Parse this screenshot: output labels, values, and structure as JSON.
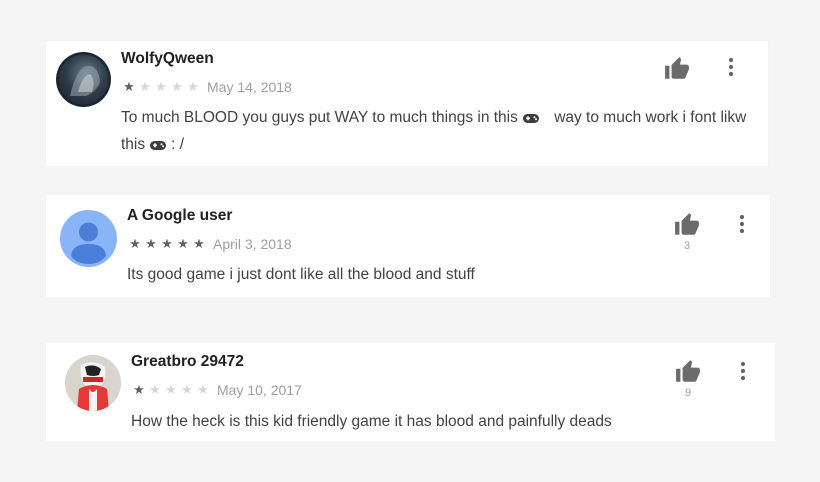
{
  "reviews": [
    {
      "name": "WolfyQween",
      "rating": 1,
      "date": "May 14, 2018",
      "text_a": "To much BLOOD you guys put WAY to much things in this",
      "text_b": "way to much work i font likw",
      "text_c": "this",
      "text_d": ": /",
      "helpful_count": "",
      "avatar_text": "WolfyQween"
    },
    {
      "name": "A Google user",
      "rating": 5,
      "date": "April 3, 2018",
      "text_a": "Its good game i just dont like all the blood and stuff",
      "helpful_count": "3"
    },
    {
      "name": "Greatbro 29472",
      "rating": 1,
      "date": "May 10, 2017",
      "text_a": "How the heck is this kid friendly game it has blood and painfully deads",
      "helpful_count": "9"
    }
  ],
  "colors": {
    "background": "#f5f5f5",
    "card": "#ffffff",
    "star_full": "#616161",
    "star_empty": "#d5d5d5",
    "default_avatar": "#8ab4f8",
    "default_avatar_figure": "#4a7ed8"
  },
  "icons": {
    "like": "thumbs-up-icon",
    "more": "more-vert-icon",
    "emoji": "gamepad-emoji-icon",
    "star": "star-icon"
  }
}
